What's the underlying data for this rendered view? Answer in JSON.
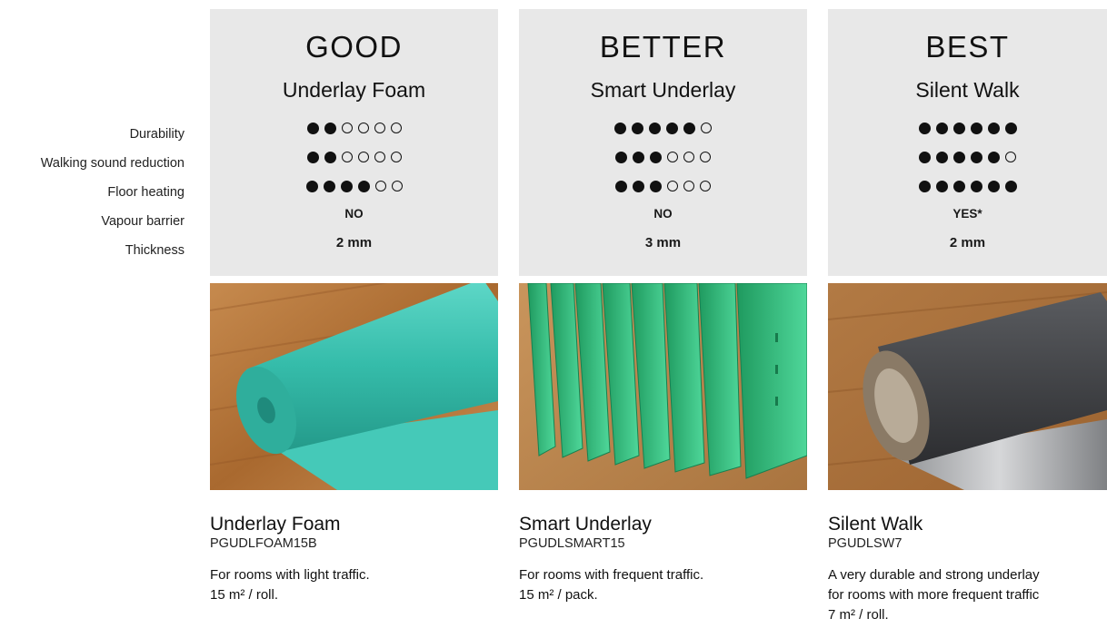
{
  "row_labels": [
    "Durability",
    "Walking sound reduction",
    "Floor heating",
    "Vapour barrier",
    "Thickness"
  ],
  "products": [
    {
      "tier": "GOOD",
      "name": "Underlay Foam",
      "durability": 2,
      "sound": 2,
      "heating": 4,
      "vapour": "NO",
      "thickness": "2 mm",
      "product_name": "Underlay Foam",
      "code": "PGUDLFOAM15B",
      "desc": [
        "For rooms with light traffic.",
        "15 m² / roll."
      ]
    },
    {
      "tier": "BETTER",
      "name": "Smart Underlay",
      "durability": 5,
      "sound": 3,
      "heating": 3,
      "vapour": "NO",
      "thickness": "3 mm",
      "product_name": "Smart Underlay",
      "code": "PGUDLSMART15",
      "desc": [
        "For rooms with frequent traffic.",
        "15 m² / pack."
      ]
    },
    {
      "tier": "BEST",
      "name": "Silent Walk",
      "durability": 6,
      "sound": 5,
      "heating": 6,
      "vapour": "YES*",
      "thickness": "2 mm",
      "product_name": "Silent Walk",
      "code": "PGUDLSW7",
      "desc": [
        "A very durable and strong underlay",
        "for rooms with more frequent traffic",
        "7 m² / roll."
      ]
    }
  ],
  "rating_max": 6,
  "colors": {
    "card": "#e8e8e8",
    "dot": "#111111",
    "wood": "#b5773c",
    "foam": "#37bfae",
    "smart": "#2ebd7a",
    "silent": "#3a3b3d"
  }
}
